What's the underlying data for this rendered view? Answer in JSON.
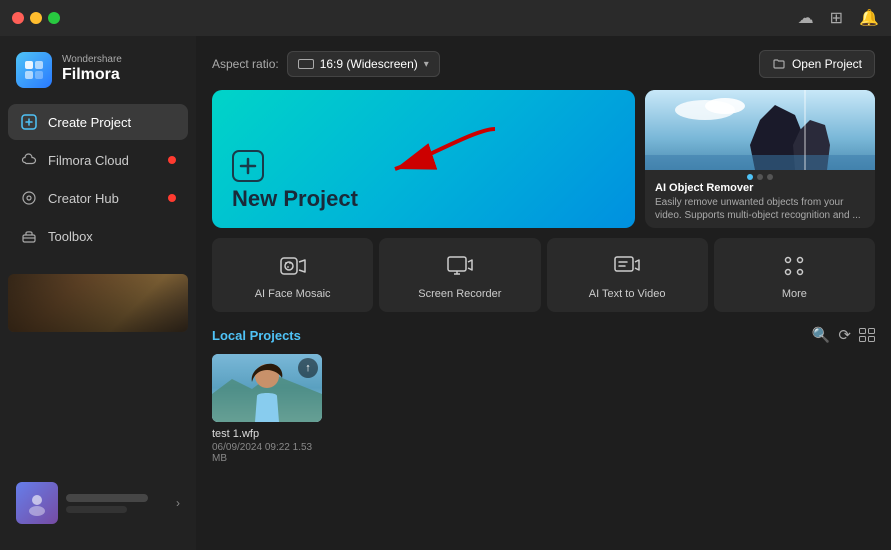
{
  "titlebar": {
    "dots": [
      "red",
      "yellow",
      "green"
    ]
  },
  "sidebar": {
    "logo": {
      "brand": "Wondershare",
      "name": "Filmora",
      "icon_char": "F"
    },
    "nav": [
      {
        "id": "create-project",
        "label": "Create Project",
        "active": true,
        "badge": false
      },
      {
        "id": "filmora-cloud",
        "label": "Filmora Cloud",
        "active": false,
        "badge": true
      },
      {
        "id": "creator-hub",
        "label": "Creator Hub",
        "active": false,
        "badge": true
      },
      {
        "id": "toolbox",
        "label": "Toolbox",
        "active": false,
        "badge": false
      }
    ]
  },
  "topbar": {
    "aspect_ratio_label": "Aspect ratio:",
    "aspect_ratio_value": "16:9 (Widescreen)",
    "open_project_label": "Open Project"
  },
  "new_project": {
    "label": "New Project"
  },
  "ai_feature": {
    "title": "AI Object Remover",
    "description": "Easily remove unwanted objects from your video. Supports multi-object recognition and ...",
    "dots": [
      true,
      false,
      false
    ]
  },
  "quick_actions": [
    {
      "id": "ai-face-mosaic",
      "label": "AI Face Mosaic",
      "icon": "face-mosaic"
    },
    {
      "id": "screen-recorder",
      "label": "Screen Recorder",
      "icon": "screen-record"
    },
    {
      "id": "ai-text-to-video",
      "label": "AI Text to Video",
      "icon": "text-video"
    },
    {
      "id": "more",
      "label": "More",
      "icon": "more-grid"
    }
  ],
  "local_projects": {
    "section_title": "Local Projects",
    "projects": [
      {
        "name": "test 1.wfp",
        "date": "06/09/2024 09:22",
        "size": "1.53 MB"
      }
    ]
  }
}
